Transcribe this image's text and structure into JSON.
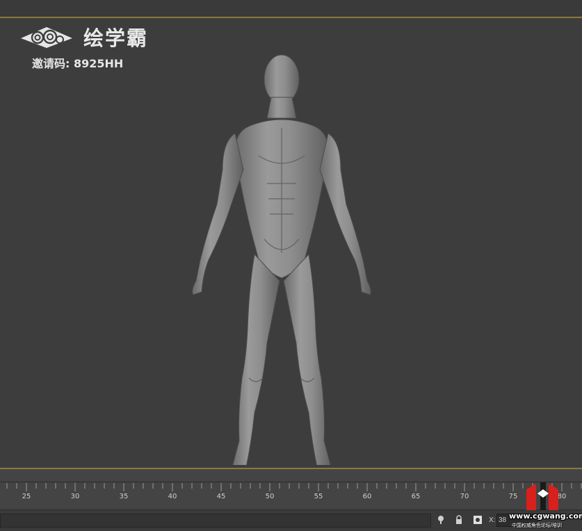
{
  "overlay": {
    "brand_name": "绘学霸",
    "invite_code": "邀请码: 8925HH"
  },
  "timeline": {
    "tick_labels": [
      "25",
      "30",
      "35",
      "40",
      "45",
      "50",
      "55",
      "60",
      "65",
      "70",
      "75",
      "80"
    ]
  },
  "statusbar": {
    "coord_label": "X:",
    "coord_value": "38"
  },
  "watermark": {
    "url": "www.cgwang.com",
    "subtitle": "中国权威角色论坛/培训"
  },
  "colors": {
    "viewport_bg": "#3d3d3d",
    "viewport_border": "#8c7a3c",
    "model": "#8a8a8a",
    "watermark_red": "#d8201c"
  }
}
